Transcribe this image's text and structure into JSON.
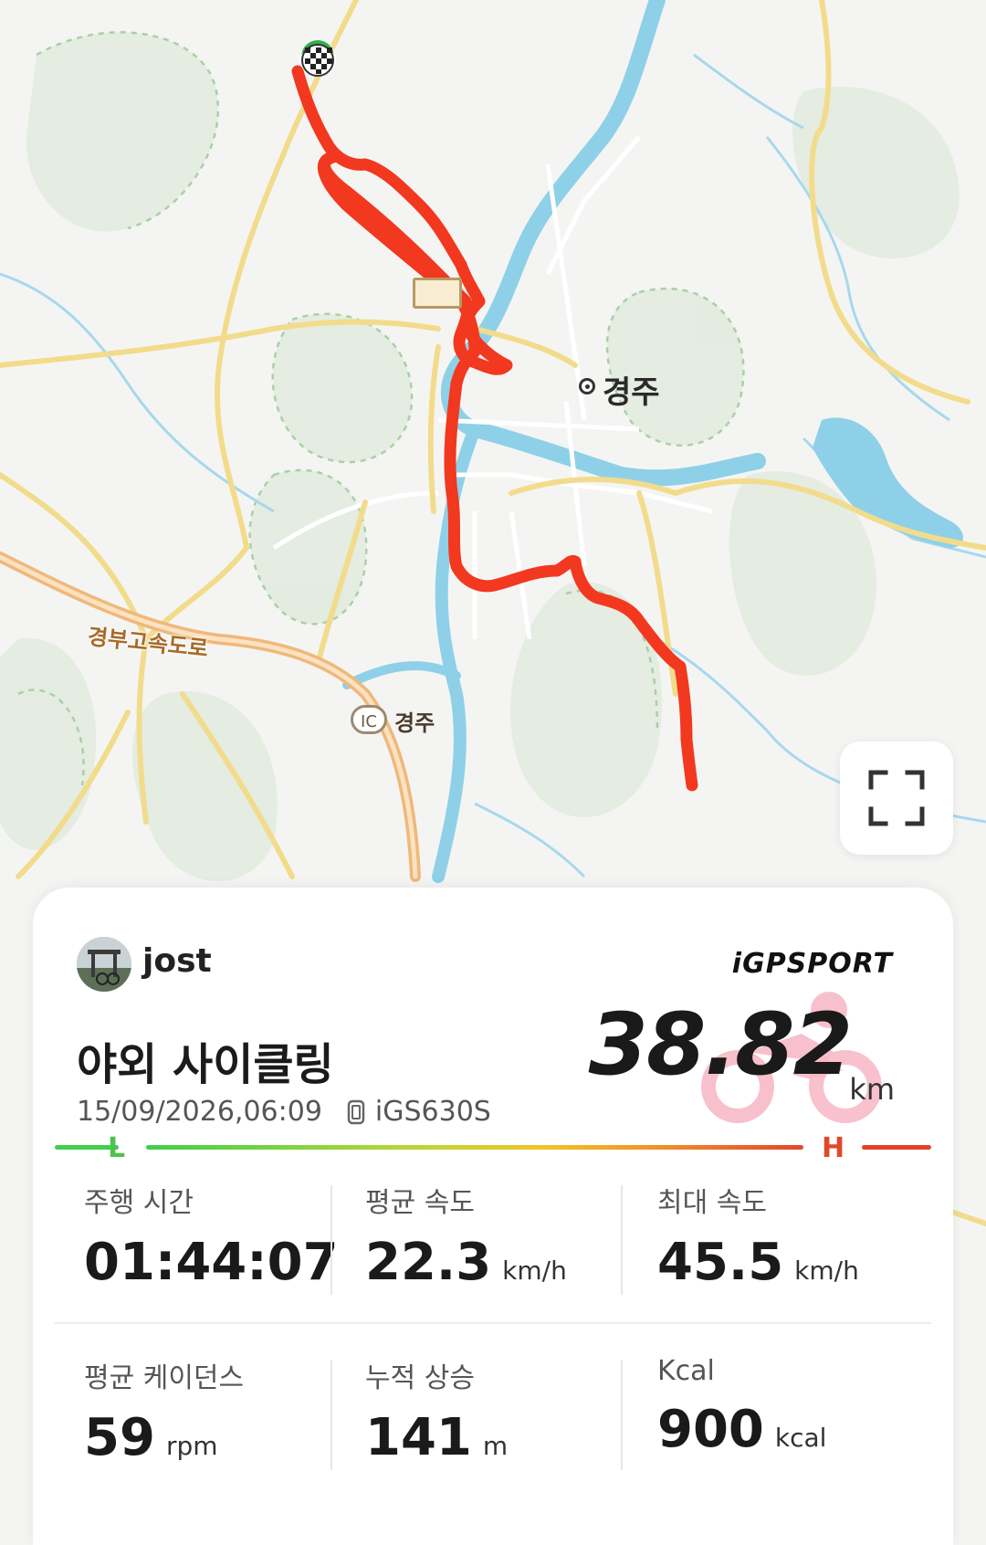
{
  "map": {
    "city_label": "경주",
    "highway_label": "경부고속도로",
    "ic_badge": "IC",
    "ic_label": "경주"
  },
  "expand_button": {
    "icon": "expand-icon"
  },
  "card": {
    "username": "jost",
    "brand": "iGPSPORT",
    "activity_title": "야외 사이클링",
    "datetime": "15/09/2026,06:09",
    "device_icon": "watch-icon",
    "device": "iGS630S",
    "distance": "38.82",
    "distance_unit": "km",
    "scale_low": "L",
    "scale_high": "H",
    "stats": [
      {
        "label": "주행 시간",
        "value": "01:44:07",
        "unit": ""
      },
      {
        "label": "평균 속도",
        "value": "22.3",
        "unit": "km/h"
      },
      {
        "label": "최대 속도",
        "value": "45.5",
        "unit": "km/h"
      },
      {
        "label": "평균 케이던스",
        "value": "59",
        "unit": "rpm"
      },
      {
        "label": "누적 상승",
        "value": "141",
        "unit": "m"
      },
      {
        "label": "Kcal",
        "value": "900",
        "unit": "kcal"
      }
    ]
  },
  "colors": {
    "route": "#f2381f",
    "river": "#8fd0e9",
    "road_yellow": "#f2dc8c",
    "highway": "#f0b87a",
    "park": "#dfe8dc"
  }
}
